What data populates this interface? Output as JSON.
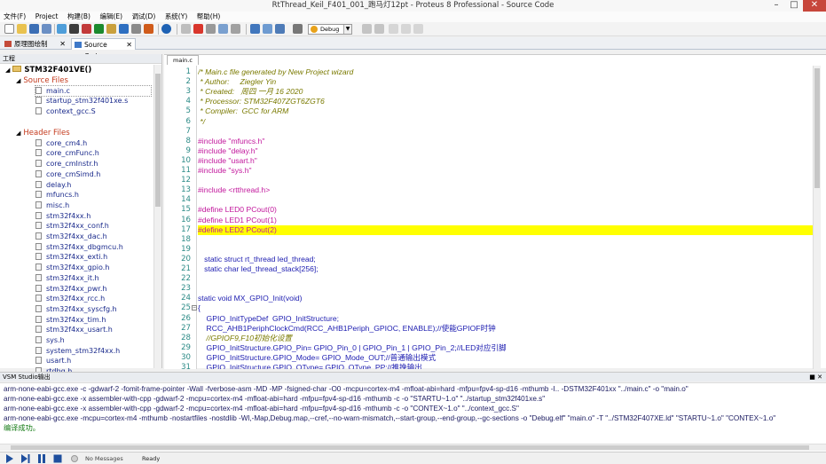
{
  "window": {
    "title": "RtThread_Keil_F401_001_跑马灯12pt - Proteus 8 Professional - Source Code"
  },
  "menu": [
    "文件(F)",
    "Project",
    "构建(B)",
    "编辑(E)",
    "调试(D)",
    "系统(Y)",
    "帮助(H)"
  ],
  "toolbar": {
    "build_config": "Debug"
  },
  "tabs": [
    {
      "label": "原理图绘制",
      "active": false
    },
    {
      "label": "Source Code",
      "active": true
    }
  ],
  "project": {
    "header": "工程",
    "root": "STM32F401VE()",
    "source_group": "Source Files",
    "source_files": [
      "main.c",
      "startup_stm32f401xe.s",
      "context_gcc.S"
    ],
    "header_group": "Header Files",
    "header_files": [
      "core_cm4.h",
      "core_cmFunc.h",
      "core_cmInstr.h",
      "core_cmSimd.h",
      "delay.h",
      "mfuncs.h",
      "misc.h",
      "stm32f4xx.h",
      "stm32f4xx_conf.h",
      "stm32f4xx_dac.h",
      "stm32f4xx_dbgmcu.h",
      "stm32f4xx_exti.h",
      "stm32f4xx_gpio.h",
      "stm32f4xx_it.h",
      "stm32f4xx_pwr.h",
      "stm32f4xx_rcc.h",
      "stm32f4xx_syscfg.h",
      "stm32f4xx_tim.h",
      "stm32f4xx_usart.h",
      "sys.h",
      "system_stm32f4xx.h",
      "usart.h",
      "rtdbg.h"
    ]
  },
  "editor": {
    "file_tab": "main.c",
    "highlighted_line": 17,
    "lines": [
      {
        "n": 1,
        "t": "/* Main.c file generated by New Project wizard",
        "k": "comment"
      },
      {
        "n": 2,
        "t": " * Author:     Ziegler Yin",
        "k": "comment"
      },
      {
        "n": 3,
        "t": " * Created:   周四 一月 16 2020",
        "k": "comment"
      },
      {
        "n": 4,
        "t": " * Processor: STM32F407ZGT6ZGT6",
        "k": "comment"
      },
      {
        "n": 5,
        "t": " * Compiler:  GCC for ARM",
        "k": "comment"
      },
      {
        "n": 6,
        "t": " */",
        "k": "comment"
      },
      {
        "n": 7,
        "t": "",
        "k": "plain"
      },
      {
        "n": 8,
        "t": "#include \"mfuncs.h\"",
        "k": "pre"
      },
      {
        "n": 9,
        "t": "#include \"delay.h\"",
        "k": "pre"
      },
      {
        "n": 10,
        "t": "#include \"usart.h\"",
        "k": "pre"
      },
      {
        "n": 11,
        "t": "#include \"sys.h\"",
        "k": "pre"
      },
      {
        "n": 12,
        "t": "",
        "k": "plain"
      },
      {
        "n": 13,
        "t": "#include <rtthread.h>",
        "k": "pre"
      },
      {
        "n": 14,
        "t": "",
        "k": "plain"
      },
      {
        "n": 15,
        "t": "#define LED0 PCout(0)",
        "k": "pre"
      },
      {
        "n": 16,
        "t": "#define LED1 PCout(1)",
        "k": "pre"
      },
      {
        "n": 17,
        "t": "#define LED2 PCout(2)",
        "k": "pre"
      },
      {
        "n": 18,
        "t": "",
        "k": "plain"
      },
      {
        "n": 19,
        "t": "",
        "k": "plain"
      },
      {
        "n": 20,
        "t": "   static struct rt_thread led_thread;",
        "k": "plain"
      },
      {
        "n": 21,
        "t": "   static char led_thread_stack[256];",
        "k": "plain"
      },
      {
        "n": 22,
        "t": "",
        "k": "plain"
      },
      {
        "n": 23,
        "t": "",
        "k": "plain"
      },
      {
        "n": 24,
        "t": "static void MX_GPIO_Init(void)",
        "k": "plain"
      },
      {
        "n": 25,
        "t": "{",
        "k": "plain"
      },
      {
        "n": 26,
        "t": "    GPIO_InitTypeDef  GPIO_InitStructure;",
        "k": "plain"
      },
      {
        "n": 27,
        "t": "    RCC_AHB1PeriphClockCmd(RCC_AHB1Periph_GPIOC, ENABLE);//使能GPIOF时钟",
        "k": "plain"
      },
      {
        "n": 28,
        "t": "    //GPIOF9,F10初始化设置",
        "k": "comment"
      },
      {
        "n": 29,
        "t": "    GPIO_InitStructure.GPIO_Pin= GPIO_Pin_0 | GPIO_Pin_1 | GPIO_Pin_2;//LED对应引脚",
        "k": "plain"
      },
      {
        "n": 30,
        "t": "    GPIO_InitStructure.GPIO_Mode= GPIO_Mode_OUT;//普通输出模式",
        "k": "plain"
      },
      {
        "n": 31,
        "t": "    GPIO_InitStructure.GPIO_OType= GPIO_OType_PP;//推挽输出",
        "k": "plain"
      }
    ]
  },
  "output": {
    "header": "VSM Studio输出",
    "lines": [
      "arm-none-eabi-gcc.exe -c -gdwarf-2 -fomit-frame-pointer -Wall -fverbose-asm -MD -MP -fsigned-char -O0 -mcpu=cortex-m4 -mfloat-abi=hard -mfpu=fpv4-sp-d16 -mthumb -I.. -DSTM32F401xx   \"../main.c\" -o \"main.o\"",
      "arm-none-eabi-gcc.exe -x assembler-with-cpp -gdwarf-2 -mcpu=cortex-m4 -mfloat-abi=hard -mfpu=fpv4-sp-d16 -mthumb -c  -o \"STARTU~1.o\" \"../startup_stm32f401xe.s\"",
      "arm-none-eabi-gcc.exe -x assembler-with-cpp -gdwarf-2 -mcpu=cortex-m4 -mfloat-abi=hard -mfpu=fpv4-sp-d16 -mthumb -c  -o \"CONTEX~1.o\" \"../context_gcc.S\"",
      "arm-none-eabi-gcc.exe -mcpu=cortex-m4 -mthumb -nostartfiles -nostdlib  -Wl,-Map,Debug.map,--cref,--no-warn-mismatch,--start-group,--end-group,--gc-sections -o \"Debug.elf\" \"main.o\" -T \"../STM32F407XE.ld\" \"STARTU~1.o\" \"CONTEX~1.o\"",
      "编译成功。"
    ]
  },
  "status": {
    "messages": "No Messages",
    "state": "Ready"
  },
  "colors": {
    "comment": "#7a7a00",
    "pre": "#c2179c",
    "plain": "#1c1cb0",
    "highlight": "#ffff00",
    "line_number": "#2b8a86"
  }
}
